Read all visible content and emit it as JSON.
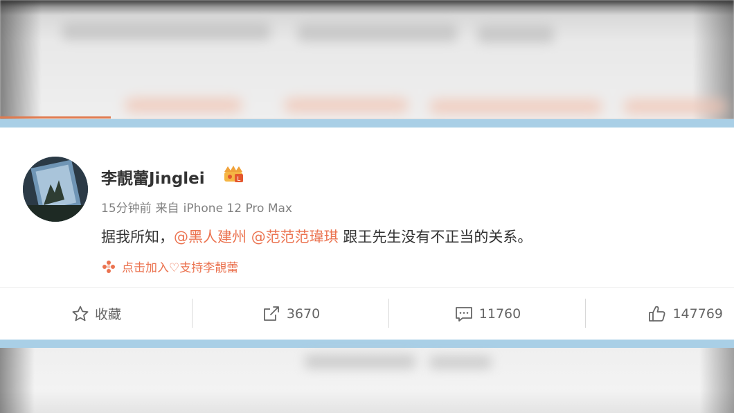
{
  "post": {
    "author": {
      "name": "李靚蕾Jinglei",
      "avatar_icon": "avatar-photo",
      "badge_icon": "vip-crown-icon"
    },
    "meta": {
      "time": "15分钟前",
      "source_prefix": "来自",
      "device": "iPhone 12 Pro Max"
    },
    "content": {
      "prefix": "据我所知，",
      "mentions": [
        "@黑人建州",
        "@范范范瑋琪"
      ],
      "suffix": "跟王先生没有不正当的关系。"
    },
    "promo": {
      "icon": "flower-icon",
      "label": "点击加入♡支持李靚蕾"
    },
    "actions": {
      "favorite": {
        "icon": "star-icon",
        "label": "收藏"
      },
      "repost": {
        "icon": "share-icon",
        "count": "3670"
      },
      "comment": {
        "icon": "comment-icon",
        "count": "11760"
      },
      "like": {
        "icon": "thumbs-up-icon",
        "count": "147769"
      }
    }
  },
  "colors": {
    "accent": "#eb7350",
    "text": "#333333",
    "meta": "#808080",
    "frame": "#a9cfe6"
  }
}
